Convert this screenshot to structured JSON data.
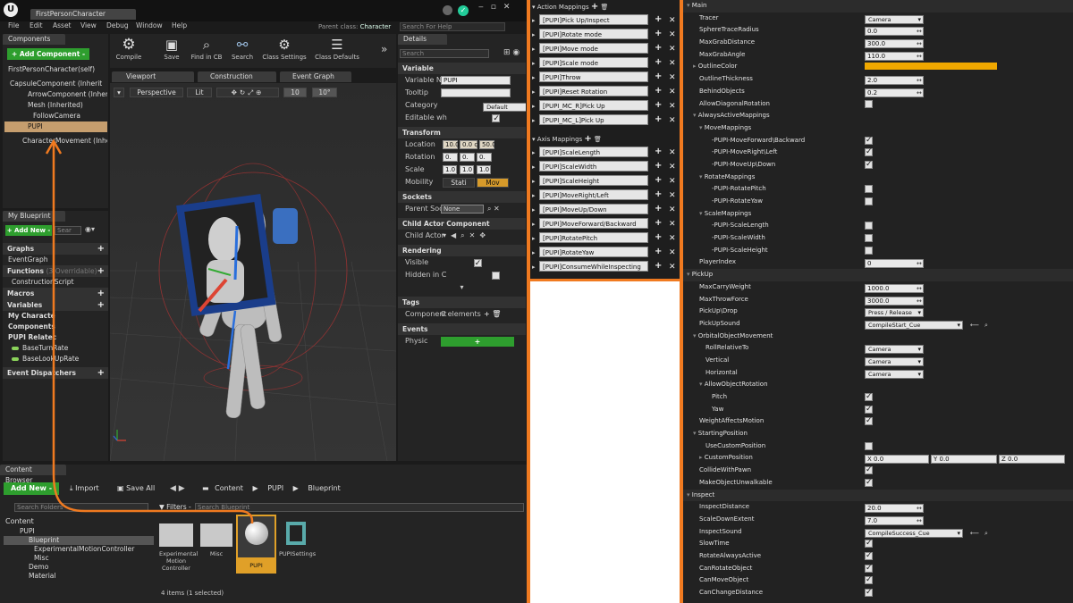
{
  "window": {
    "tab": "FirstPersonCharacter",
    "parent_label": "Parent class:",
    "parent_value": "Character",
    "search_placeholder": "Search For Help"
  },
  "menu": [
    "File",
    "Edit",
    "Asset",
    "View",
    "Debug",
    "Window",
    "Help"
  ],
  "components": {
    "tab": "Components",
    "add_btn": "+ Add Component -",
    "items": [
      "FirstPersonCharacter(self)",
      "CapsuleComponent (Inherit",
      "ArrowComponent (Inherite",
      "Mesh (Inherited)",
      "FollowCamera",
      "PUPI",
      "CharacterMovement (Inherit"
    ]
  },
  "toolbar": [
    "Compile",
    "Save",
    "Find in CB",
    "Search",
    "Class Settings",
    "Class Defaults"
  ],
  "editor_tabs": [
    "Viewport",
    "Construction Script",
    "Event Graph"
  ],
  "viewport": {
    "perspective": "Perspective",
    "lit": "Lit",
    "grid": "10",
    "angle": "10°"
  },
  "myblueprint": {
    "tab": "My Blueprint",
    "add_new": "+ Add New -",
    "search_placeholder": "Sear",
    "graphs": "Graphs",
    "event_graph": "EventGraph",
    "functions": "Functions",
    "overridable": "(3 Overridable)",
    "construction": "ConstructionScript",
    "macros": "Macros",
    "variables": "Variables",
    "my_character": "My Characte",
    "components": "Components",
    "pupi_related": "PUPI Relatec",
    "base_turn": "BaseTurnRate",
    "base_lookup": "BaseLookUpRate",
    "dispatchers": "Event Dispatchers"
  },
  "details": {
    "tab": "Details",
    "search_placeholder": "Search",
    "variable_sec": "Variable",
    "var_name_label": "Variable Nai",
    "var_name": "PUPI",
    "tooltip": "Tooltip",
    "category": "Category",
    "category_val": "Default",
    "editable": "Editable wh",
    "transform_sec": "Transform",
    "location": "Location",
    "loc": [
      "10.0",
      "0.0 c",
      "50.0"
    ],
    "rotation": "Rotation",
    "rot": [
      "0.",
      "0.",
      "0."
    ],
    "scale": "Scale",
    "scl": [
      "1.0",
      "1.0",
      "1.0"
    ],
    "mobility": "Mobility",
    "stati": "Stati",
    "movable": "Mov",
    "sockets_sec": "Sockets",
    "parent_socket": "Parent Soc",
    "none": "None",
    "child_sec": "Child Actor Component",
    "child_actor": "Child Actor",
    "rendering_sec": "Rendering",
    "visible": "Visible",
    "hidden": "Hidden in C",
    "tags_sec": "Tags",
    "component": "Component",
    "elements": "0 elements",
    "events_sec": "Events",
    "physic": "Physic"
  },
  "content": {
    "tab": "Content Browser",
    "add_new": "Add New -",
    "import": "Import",
    "save_all": "Save All",
    "path": [
      "Content",
      "PUPI",
      "Blueprint"
    ],
    "search_folders": "Search Folders",
    "filters": "Filters -",
    "search_bp": "Search Blueprint",
    "tree": [
      "Content",
      "PUPI",
      "Blueprint",
      "ExperimentalMotionController",
      "Misc",
      "Demo",
      "Material"
    ],
    "assets": [
      "Experimental Motion Controller",
      "Misc",
      "PUPI",
      "PUPISettings"
    ],
    "count": "4 items (1 selected)"
  },
  "action_mappings": {
    "title": "Action Mappings",
    "items": [
      "[PUPI]Pick Up/Inspect",
      "[PUPI]Rotate mode",
      "[PUPI]Move mode",
      "[PUPI]Scale mode",
      "[PUPI]Throw",
      "[PUPI]Reset Rotation",
      "[PUPI_MC_R]Pick Up",
      "[PUPI_MC_L]Pick Up"
    ]
  },
  "axis_mappings": {
    "title": "Axis Mappings",
    "items": [
      "[PUPI]ScaleLength",
      "[PUPI]ScaleWidth",
      "[PUPI]ScaleHeight",
      "[PUPI]MoveRight/Left",
      "[PUPI]MoveUp/Down",
      "[PUPI]MoveForward/Backward",
      "[PUPI]RotatePitch",
      "[PUPI]RotateYaw",
      "[PUPI]ConsumeWhileInspecting"
    ]
  },
  "props": [
    {
      "l": "Main",
      "i": 0,
      "sec": true
    },
    {
      "l": "Tracer",
      "i": 2,
      "t": "drop",
      "v": "Camera"
    },
    {
      "l": "SphereTraceRadius",
      "i": 2,
      "t": "num",
      "v": "0.0"
    },
    {
      "l": "MaxGrabDistance",
      "i": 2,
      "t": "num",
      "v": "300.0"
    },
    {
      "l": "MaxGrabAngle",
      "i": 2,
      "t": "num",
      "v": "110.0"
    },
    {
      "l": "OutlineColor",
      "i": 1,
      "t": "color"
    },
    {
      "l": "OutlineThickness",
      "i": 2,
      "t": "num",
      "v": "2.0"
    },
    {
      "l": "BehindObjects",
      "i": 2,
      "t": "num",
      "v": "0.2"
    },
    {
      "l": "AllowDiagonalRotation",
      "i": 2,
      "t": "ck",
      "v": "0"
    },
    {
      "l": "AlwaysActiveMappings",
      "i": 1,
      "sub": true
    },
    {
      "l": "MoveMappings",
      "i": 2,
      "sub": true
    },
    {
      "l": "-PUPI-MoveForward\\Backward",
      "i": 4,
      "t": "ck",
      "v": "1"
    },
    {
      "l": "-PUPI-MoveRight\\Left",
      "i": 4,
      "t": "ck",
      "v": "1"
    },
    {
      "l": "-PUPI-MoveUp\\Down",
      "i": 4,
      "t": "ck",
      "v": "1"
    },
    {
      "l": "RotateMappings",
      "i": 2,
      "sub": true
    },
    {
      "l": "-PUPI-RotatePitch",
      "i": 4,
      "t": "ck",
      "v": "0"
    },
    {
      "l": "-PUPI-RotateYaw",
      "i": 4,
      "t": "ck",
      "v": "0"
    },
    {
      "l": "ScaleMappings",
      "i": 2,
      "sub": true
    },
    {
      "l": "-PUPI-ScaleLength",
      "i": 4,
      "t": "ck",
      "v": "0"
    },
    {
      "l": "-PUPI-ScaleWidth",
      "i": 4,
      "t": "ck",
      "v": "0"
    },
    {
      "l": "-PUPI-ScaleHeight",
      "i": 4,
      "t": "ck",
      "v": "0"
    },
    {
      "l": "PlayerIndex",
      "i": 2,
      "t": "num",
      "v": "0"
    },
    {
      "l": "PickUp",
      "i": 0,
      "sec": true
    },
    {
      "l": "MaxCarryWeight",
      "i": 2,
      "t": "num",
      "v": "1000.0"
    },
    {
      "l": "MaxThrowForce",
      "i": 2,
      "t": "num",
      "v": "3000.0"
    },
    {
      "l": "PickUp\\Drop",
      "i": 2,
      "t": "drop",
      "v": "Press / Release"
    },
    {
      "l": "PickUpSound",
      "i": 2,
      "t": "sound",
      "v": "CompileStart_Cue"
    },
    {
      "l": "OrbitalObjectMovement",
      "i": 1,
      "sub": true
    },
    {
      "l": "RollRelativeTo",
      "i": 3,
      "t": "drop",
      "v": "Camera"
    },
    {
      "l": "Vertical",
      "i": 3,
      "t": "drop",
      "v": "Camera"
    },
    {
      "l": "Horizontal",
      "i": 3,
      "t": "drop",
      "v": "Camera"
    },
    {
      "l": "AllowObjectRotation",
      "i": 2,
      "sub": true
    },
    {
      "l": "Pitch",
      "i": 4,
      "t": "ck",
      "v": "1"
    },
    {
      "l": "Yaw",
      "i": 4,
      "t": "ck",
      "v": "1"
    },
    {
      "l": "WeightAffectsMotion",
      "i": 2,
      "t": "ck",
      "v": "1"
    },
    {
      "l": "StartingPosition",
      "i": 1,
      "sub": true
    },
    {
      "l": "UseCustomPosition",
      "i": 3,
      "t": "ck",
      "v": "0"
    },
    {
      "l": "CustomPosition",
      "i": 2,
      "t": "xyz",
      "x": "X  0.0",
      "y": "Y  0.0",
      "z": "Z  0.0"
    },
    {
      "l": "CollideWithPawn",
      "i": 2,
      "t": "ck",
      "v": "1"
    },
    {
      "l": "MakeObjectUnwalkable",
      "i": 2,
      "t": "ck",
      "v": "1"
    },
    {
      "l": "Inspect",
      "i": 0,
      "sec": true
    },
    {
      "l": "InspectDistance",
      "i": 2,
      "t": "num",
      "v": "20.0"
    },
    {
      "l": "ScaleDownExtent",
      "i": 2,
      "t": "num",
      "v": "7.0"
    },
    {
      "l": "InspectSound",
      "i": 2,
      "t": "sound",
      "v": "CompileSuccess_Cue"
    },
    {
      "l": "SlowTime",
      "i": 2,
      "t": "ck",
      "v": "1"
    },
    {
      "l": "RotateAlwaysActive",
      "i": 2,
      "t": "ck",
      "v": "1"
    },
    {
      "l": "CanRotateObject",
      "i": 2,
      "t": "ck",
      "v": "1"
    },
    {
      "l": "CanMoveObject",
      "i": 2,
      "t": "ck",
      "v": "1"
    },
    {
      "l": "CanChangeDistance",
      "i": 2,
      "t": "ck",
      "v": "1"
    }
  ],
  "colors": {
    "accent": "#f07a20",
    "outline": "#f0a800",
    "green": "#2e9e2e"
  }
}
